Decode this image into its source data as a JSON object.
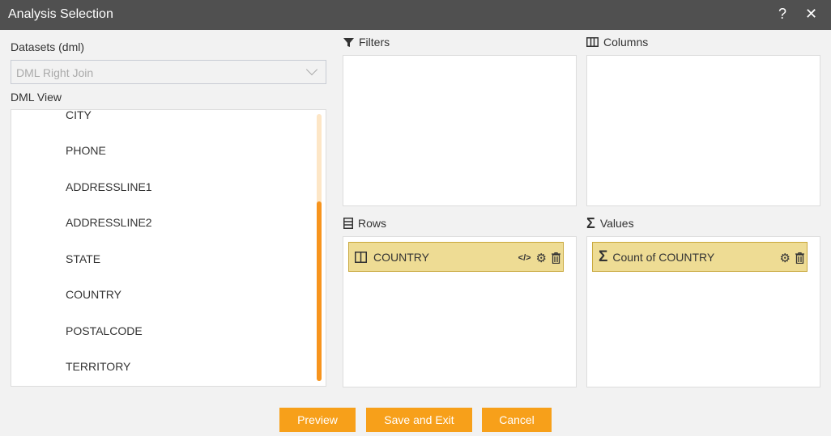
{
  "window": {
    "title": "Analysis Selection",
    "help": "?",
    "close": "✕"
  },
  "datasets": {
    "label": "Datasets (dml)",
    "selected": "DML Right Join"
  },
  "dml_view": {
    "label": "DML View",
    "items": [
      "CITY",
      "PHONE",
      "ADDRESSLINE1",
      "ADDRESSLINE2",
      "STATE",
      "COUNTRY",
      "POSTALCODE",
      "TERRITORY"
    ],
    "scroll_thumb_color": "#f7941d"
  },
  "filters": {
    "label": "Filters"
  },
  "columns": {
    "label": "Columns"
  },
  "rows": {
    "label": "Rows",
    "items": [
      {
        "label": "COUNTRY"
      }
    ]
  },
  "values": {
    "label": "Values",
    "items": [
      {
        "label": "Count of COUNTRY"
      }
    ]
  },
  "buttons": {
    "preview": "Preview",
    "save_exit": "Save and Exit",
    "cancel": "Cancel"
  },
  "colors": {
    "accent": "#f7a01a",
    "chip": "#eedc94",
    "titlebar": "#505050"
  }
}
